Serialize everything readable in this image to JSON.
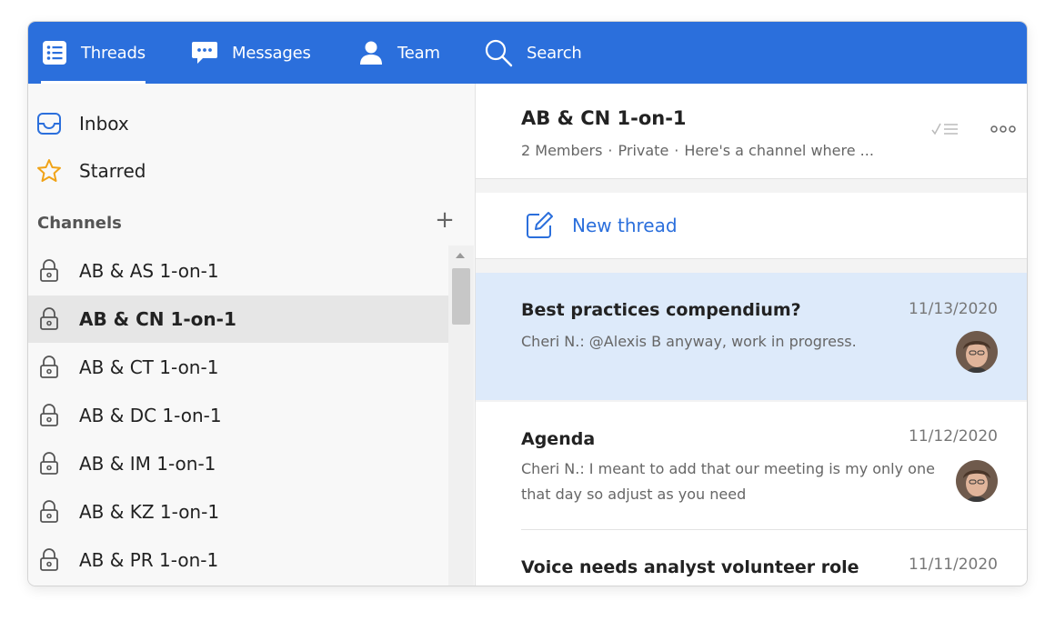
{
  "nav": {
    "items": [
      {
        "label": "Threads",
        "icon": "list-icon"
      },
      {
        "label": "Messages",
        "icon": "chat-icon"
      },
      {
        "label": "Team",
        "icon": "person-icon"
      },
      {
        "label": "Search",
        "icon": "search-icon"
      }
    ]
  },
  "sidebar": {
    "inbox_label": "Inbox",
    "starred_label": "Starred",
    "channels_header": "Channels",
    "add_channel": "+",
    "channels": [
      {
        "label": "AB & AS 1-on-1"
      },
      {
        "label": "AB & CN 1-on-1"
      },
      {
        "label": "AB & CT 1-on-1"
      },
      {
        "label": "AB & DC 1-on-1"
      },
      {
        "label": "AB & IM 1-on-1"
      },
      {
        "label": "AB & KZ 1-on-1"
      },
      {
        "label": "AB & PR 1-on-1"
      }
    ],
    "selected_channel": "AB & CN 1-on-1"
  },
  "channel": {
    "title": "AB & CN 1-on-1",
    "members": "2 Members",
    "privacy": "Private",
    "description": "Here's a channel where ...",
    "separator": "·"
  },
  "new_thread_label": "New thread",
  "threads": [
    {
      "title": "Best practices compendium?",
      "date": "11/13/2020",
      "preview": "Cheri N.: @Alexis B anyway, work in progress."
    },
    {
      "title": "Agenda",
      "date": "11/12/2020",
      "preview": "Cheri N.: I meant to add that our meeting is my only one that day so adjust as you need"
    },
    {
      "title": "Voice needs analyst volunteer role",
      "date": "11/11/2020",
      "preview": ""
    }
  ],
  "colors": {
    "accent": "#2b6fdc",
    "selected_thread_bg": "#ddeafa",
    "selected_channel_bg": "#e6e6e6",
    "star": "#f0a318"
  }
}
